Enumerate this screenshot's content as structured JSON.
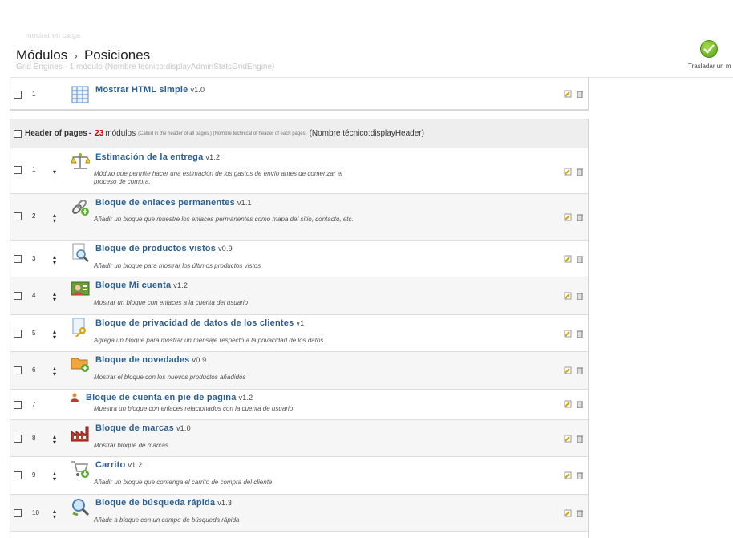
{
  "breadcrumb": {
    "root": "Módulos",
    "separator": "›",
    "current": "Posiciones"
  },
  "toolbar": {
    "save_label": "Trasladar un m"
  },
  "ghost": {
    "top": "mostrar en carga",
    "hook": "Grid Engines - 1 módulo (Nombre técnico:displayAdminStatsGridEngine)"
  },
  "hook_a": {
    "module": {
      "position": "1",
      "name": "Mostrar HTML simple",
      "version": "v1.0"
    }
  },
  "hook_b": {
    "title": "Header of pages",
    "count_prefix": "-",
    "count": "23",
    "count_label": "módulos",
    "description": "(Called in the header of all pages.) (Nombre technical of header of each pages)",
    "technical": "(Nombre técnico:displayHeader)",
    "modules": [
      {
        "position": "1",
        "name": "Estimación de la entrega",
        "version": "v1.2",
        "description": "Módulo que permite hacer una estimación de los gastos de envío antes de comenzar el proceso de compra.",
        "icon": "scale-icon"
      },
      {
        "position": "2",
        "name": "Bloque de enlaces permanentes",
        "version": "v1.1",
        "description": "Añadir un bloque que muestre los enlaces permanentes como mapa del sitio, contacto, etc.",
        "icon": "link-icon"
      },
      {
        "position": "3",
        "name": "Bloque de productos vistos",
        "version": "v0.9",
        "description": "Añadir un bloque para mostrar los últimos productos vistos",
        "icon": "magnifier-doc-icon"
      },
      {
        "position": "4",
        "name": "Bloque Mi cuenta",
        "version": "v1.2",
        "description": "Mostrar un bloque con enlaces a la cuenta del usuario",
        "icon": "account-icon"
      },
      {
        "position": "5",
        "name": "Bloque de privacidad de datos de los clientes",
        "version": "v1",
        "description": "Agrega un bloque para mostrar un mensaje respecto a la privacidad de los datos.",
        "icon": "privacy-key-icon"
      },
      {
        "position": "6",
        "name": "Bloque de novedades",
        "version": "v0.9",
        "description": "Mostrar el bloque con los nuevos productos añadidos",
        "icon": "new-products-icon"
      },
      {
        "position": "7",
        "name": "Bloque de cuenta en pie de pagina",
        "version": "v1.2",
        "description": "Muestra un bloque con enlaces relacionados con la cuenta de usuario",
        "icon": "user-icon"
      },
      {
        "position": "8",
        "name": "Bloque de marcas",
        "version": "v1.0",
        "description": "Mostrar bloque de marcas",
        "icon": "factory-icon"
      },
      {
        "position": "9",
        "name": "Carrito",
        "version": "v1.2",
        "description": "Añadir un bloque que contenga el carrito de compra del cliente",
        "icon": "cart-icon"
      },
      {
        "position": "10",
        "name": "Bloque de búsqueda rápida",
        "version": "v1.3",
        "description": "Añade a bloque con un campo de búsqueda rápida",
        "icon": "search-icon"
      }
    ]
  },
  "colors": {
    "link": "#2a5f96",
    "count": "#cc0000",
    "header_bg": "#eeeeee"
  }
}
